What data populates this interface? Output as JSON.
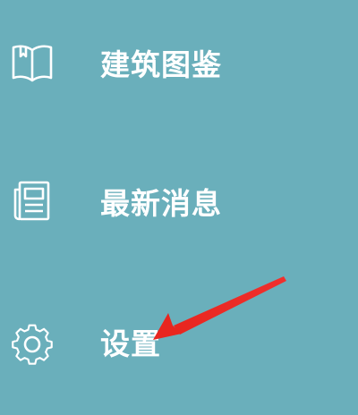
{
  "menu": {
    "items": [
      {
        "label": "建筑图鉴",
        "icon": "book-icon"
      },
      {
        "label": "最新消息",
        "icon": "newspaper-icon"
      },
      {
        "label": "设置",
        "icon": "gear-icon"
      }
    ]
  },
  "annotation": {
    "arrow_color": "#f0302d",
    "target": "settings"
  },
  "colors": {
    "background": "#6aafbb",
    "text": "#ffffff"
  }
}
